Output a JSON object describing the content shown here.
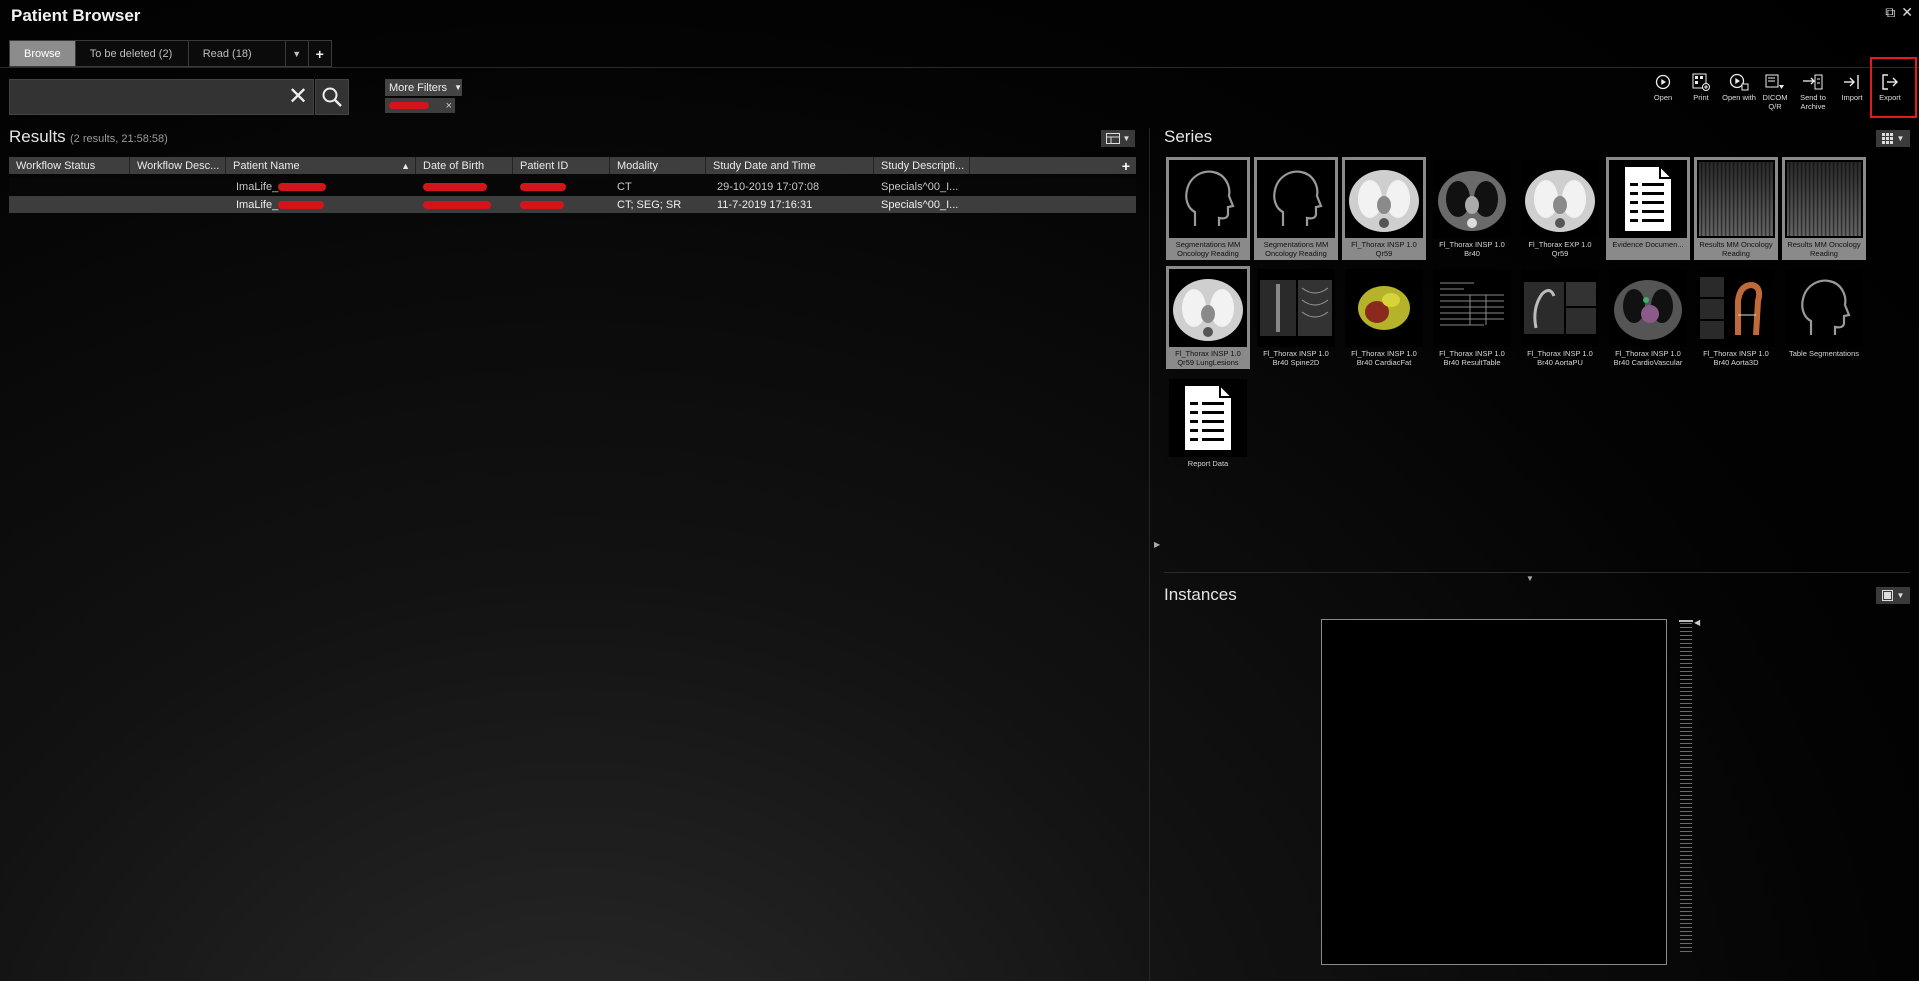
{
  "window": {
    "title": "Patient Browser",
    "restore_icon": "⧉",
    "close_icon": "✕"
  },
  "tabs": [
    {
      "label": "Browse"
    },
    {
      "label": "To be deleted  (2)"
    },
    {
      "label": "Read  (18)"
    }
  ],
  "tab_dropdown": "▼",
  "tab_add": "+",
  "search": {
    "value": "",
    "placeholder": ""
  },
  "filters": {
    "more_label": "More Filters",
    "chip_close": "×"
  },
  "toolbar": [
    {
      "label": "Open",
      "icon": "play-circle-icon"
    },
    {
      "label": "Print",
      "icon": "print-grid-icon"
    },
    {
      "label": "Open with",
      "icon": "open-with-icon"
    },
    {
      "label": "DICOM Q/R",
      "icon": "dicom-qr-icon"
    },
    {
      "label": "Send to Archive",
      "icon": "archive-icon"
    },
    {
      "label": "Import",
      "icon": "import-icon"
    },
    {
      "label": "Export",
      "icon": "export-icon"
    }
  ],
  "results": {
    "title": "Results",
    "subtitle": "(2 results, 21:58:58)",
    "columns": [
      "Workflow Status",
      "Workflow Desc...",
      "Patient Name",
      "Date of Birth",
      "Patient ID",
      "Modality",
      "Study Date and Time",
      "Study Descripti..."
    ],
    "add_col": "+",
    "sort_icon": "▲",
    "rows": [
      {
        "workflow_status": "",
        "workflow_desc": "",
        "patient_name": "ImaLife_",
        "dob": "",
        "patient_id": "",
        "modality": "CT",
        "study_datetime": "29-10-2019 17:07:08",
        "study_desc": "Specials^00_I..."
      },
      {
        "workflow_status": "",
        "workflow_desc": "",
        "patient_name": "ImaLife_",
        "dob": "",
        "patient_id": "",
        "modality": "CT; SEG; SR",
        "study_datetime": "11-7-2019 17:16:31",
        "study_desc": "Specials^00_I..."
      }
    ]
  },
  "series": {
    "title": "Series",
    "items": [
      {
        "caption": "Segmentations MM Oncology Reading",
        "thumb": "head-silhouette",
        "selected": true
      },
      {
        "caption": "Segmentations MM Oncology Reading",
        "thumb": "head-silhouette",
        "selected": true
      },
      {
        "caption": "Fl_Thorax INSP  1.0 Qr59",
        "thumb": "lung-ct",
        "selected": true
      },
      {
        "caption": "Fl_Thorax INSP  1.0 Br40",
        "thumb": "lung-ct-dark",
        "selected": false
      },
      {
        "caption": "Fl_Thorax EXP  1.0 Qr59",
        "thumb": "lung-ct",
        "selected": false
      },
      {
        "caption": "Evidence Documen...",
        "thumb": "document",
        "selected": true
      },
      {
        "caption": "Results MM Oncology Reading",
        "thumb": "stripes",
        "selected": true
      },
      {
        "caption": "Results MM Oncology Reading",
        "thumb": "stripes",
        "selected": true
      },
      {
        "caption": "Fl_Thorax INSP  1.0 Qr59 LungLesions",
        "thumb": "lung-ct",
        "selected": true
      },
      {
        "caption": "Fl_Thorax INSP  1.0 Br40 Spine2D",
        "thumb": "spine",
        "selected": false
      },
      {
        "caption": "Fl_Thorax INSP  1.0 Br40 CardiacFat",
        "thumb": "heart-3d",
        "selected": false
      },
      {
        "caption": "Fl_Thorax INSP  1.0 Br40 ResultTable",
        "thumb": "table",
        "selected": false
      },
      {
        "caption": "Fl_Thorax INSP  1.0 Br40 AortaPU",
        "thumb": "aorta-pu",
        "selected": false
      },
      {
        "caption": "Fl_Thorax INSP  1.0 Br40 CardioVascular",
        "thumb": "cardio",
        "selected": false
      },
      {
        "caption": "Fl_Thorax INSP  1.0 Br40 Aorta3D",
        "thumb": "aorta-3d",
        "selected": false
      },
      {
        "caption": "Table Segmentations",
        "thumb": "head-silhouette",
        "selected": false
      },
      {
        "caption": "Report Data",
        "thumb": "document",
        "selected": false
      }
    ]
  },
  "instances": {
    "title": "Instances"
  },
  "colors": {
    "redaction": "#d4141b",
    "export_highlight": "#e01c1c",
    "selected_tile": "#8a8a8a"
  }
}
